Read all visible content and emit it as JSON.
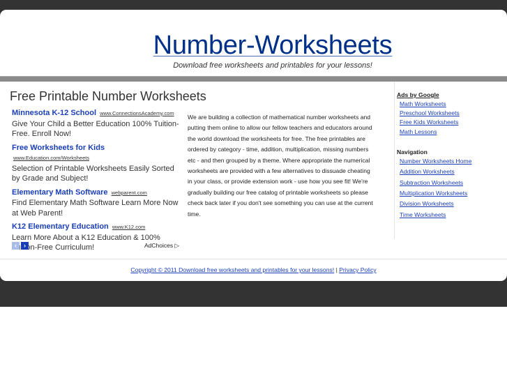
{
  "header": {
    "site_title": "Number-Worksheets",
    "tagline": "Download free worksheets and printables for your lessons!"
  },
  "main": {
    "page_title": "Free Printable Number Worksheets",
    "ads": [
      {
        "title": "Minnesota K-12 School",
        "url": "www.ConnectionsAcademy.com",
        "text": "Give Your Child a Better Education 100% Tuition-Free. Enroll Now!"
      },
      {
        "title": "Free Worksheets for Kids",
        "url": "www.Education.com/Worksheets",
        "text": "Selection of Printable Worksheets Easily Sorted by Grade and Subject!"
      },
      {
        "title": "Elementary Math Software",
        "url": "webparent.com",
        "text": "Find Elementary Math Software Learn More Now at Web Parent!"
      },
      {
        "title": "K12 Elementary Education",
        "url": "www.K12.com",
        "text": "Learn More About a K12 Education & 100% Tuition-Free Curriculum!"
      }
    ],
    "ad_prev": "‹",
    "ad_next": "›",
    "adchoices": "AdChoices",
    "intro": "We are building a collection of mathematical number worksheets and putting them online to allow our fellow teachers and educators around the world download the worksheets for free. The free printables are ordered by category - time, addition, multiplication, missing numbers etc - and then grouped by a theme. Where appropriate the numerical worksheets are provided with a few alternatives to dissuade cheating in your class, or provide extension work - use how you see fit! We're gradually building our free catalog of printable worksheets so please check back later if you don't see something you can use at the current time."
  },
  "sidebar": {
    "ads_heading": "Ads by Google",
    "ads_links": [
      "Math Worksheets",
      "Preschool Worksheets",
      "Free Kids Worksheets",
      "Math Lessons"
    ],
    "nav_heading": "Navigation",
    "nav_links": [
      "Number Worksheets Home",
      "Addition Worksheets",
      "Subtraction Worksheets",
      "Multiplication Worksheets",
      "Division Worksheets",
      "Time Worksheets"
    ]
  },
  "footer": {
    "copyright": "Copyright © 2011 Download free worksheets and printables for your lessons!",
    "separator": "|",
    "privacy": "Privacy Policy"
  },
  "colors": {
    "link": "#1a3eb8",
    "title": "#003087",
    "background_dark": "#333333",
    "band": "#8a8a8a"
  }
}
